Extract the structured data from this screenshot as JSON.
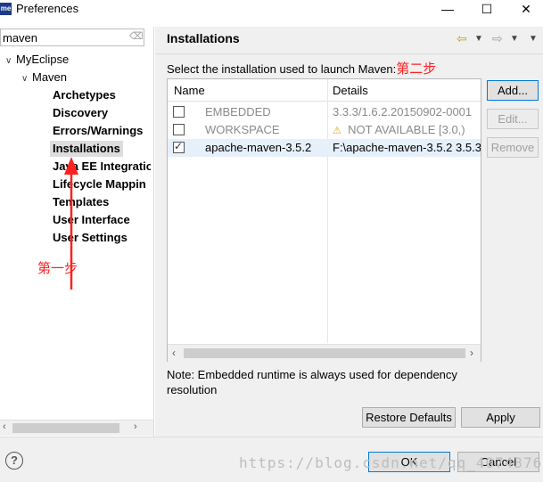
{
  "window": {
    "title": "Preferences",
    "logo": "me",
    "controls": {
      "minimize": "—",
      "maximize": "☐",
      "close": "✕"
    }
  },
  "sidebar": {
    "filter_value": "maven",
    "tree": [
      {
        "label": "MyEclipse",
        "level": 0,
        "expanded": true
      },
      {
        "label": "Maven",
        "level": 1,
        "expanded": true
      },
      {
        "label": "Archetypes",
        "level": 2
      },
      {
        "label": "Discovery",
        "level": 2
      },
      {
        "label": "Errors/Warnings",
        "level": 2
      },
      {
        "label": "Installations",
        "level": 2,
        "selected": true
      },
      {
        "label": "Java EE Integratio",
        "level": 2
      },
      {
        "label": "Lifecycle Mappin",
        "level": 2
      },
      {
        "label": "Templates",
        "level": 2
      },
      {
        "label": "User Interface",
        "level": 2
      },
      {
        "label": "User Settings",
        "level": 2
      }
    ]
  },
  "annotations": {
    "step1": "第一步",
    "step2": "第二步"
  },
  "page": {
    "title": "Installations",
    "prompt": "Select the installation used to launch Maven:",
    "columns": {
      "name": "Name",
      "details": "Details"
    },
    "rows": [
      {
        "name": "EMBEDDED",
        "details": "3.3.3/1.6.2.20150902-0001",
        "checked": false,
        "enabled": false
      },
      {
        "name": "WORKSPACE",
        "details": "NOT AVAILABLE [3.0,)",
        "checked": false,
        "enabled": false,
        "warning": true
      },
      {
        "name": "apache-maven-3.5.2",
        "details": "F:\\apache-maven-3.5.2 3.5.3",
        "checked": true,
        "enabled": true
      }
    ],
    "buttons": {
      "add": "Add...",
      "edit": "Edit...",
      "remove": "Remove"
    },
    "note": "Note: Embedded runtime is always used for dependency resolution",
    "restore_defaults": "Restore Defaults",
    "apply": "Apply"
  },
  "footer": {
    "ok": "OK",
    "cancel": "Cancel",
    "watermark": "https://blog.csdn.net/qq_40743763"
  },
  "colors": {
    "annotation": "#ff2020",
    "selection": "#e6f0fb",
    "accent": "#0078d7"
  }
}
